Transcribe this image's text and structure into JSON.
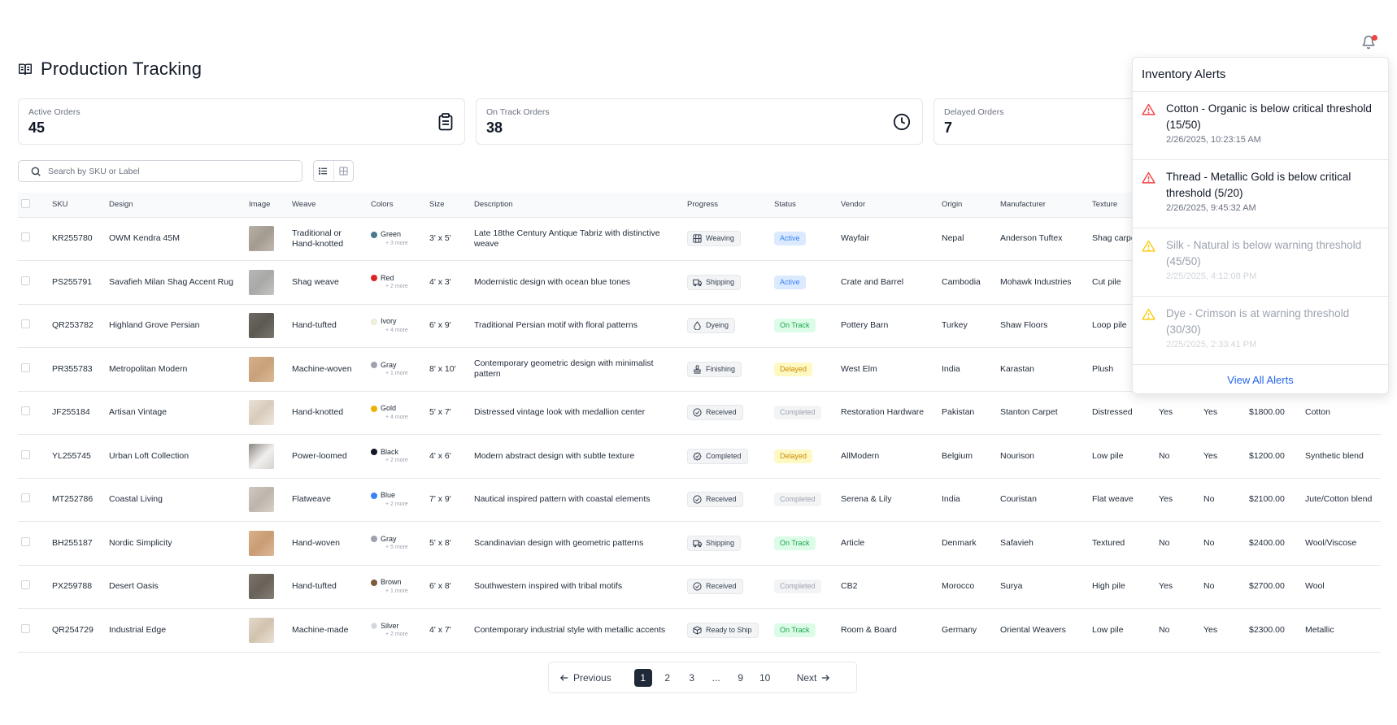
{
  "header": {
    "title": "Production Tracking"
  },
  "stats": [
    {
      "label": "Active Orders",
      "value": "45",
      "icon": "clipboard-icon"
    },
    {
      "label": "On Track Orders",
      "value": "38",
      "icon": "clock-icon"
    },
    {
      "label": "Delayed Orders",
      "value": "7",
      "icon": "alert-icon"
    }
  ],
  "search": {
    "placeholder": "Search by SKU or Label",
    "value": ""
  },
  "table": {
    "columns": [
      "SKU",
      "Design",
      "Image",
      "Weave",
      "Colors",
      "Size",
      "Description",
      "Progress",
      "Status",
      "Vendor",
      "Origin",
      "Manufacturer",
      "Texture",
      "",
      "",
      "",
      ""
    ],
    "rows": [
      {
        "sku": "KR255780",
        "design": "OWM Kendra 45M",
        "weave": "Traditional or Hand-knotted",
        "color": "Green",
        "color_more": "+ 3 more",
        "size": "3' x 5'",
        "description": "Late 18the Century Antique Tabriz with distinctive weave",
        "progress": "Weaving",
        "status": "Active",
        "vendor": "Wayfair",
        "origin": "Nepal",
        "manufacturer": "Anderson Tuftex",
        "texture": "Shag carpet",
        "c1": "",
        "c2": "",
        "price": "",
        "material": ""
      },
      {
        "sku": "PS255791",
        "design": "Savafieh Milan Shag Accent Rug",
        "weave": "Shag weave",
        "color": "Red",
        "color_more": "+ 2 more",
        "size": "4' x 3'",
        "description": "Modernistic design with ocean blue tones",
        "progress": "Shipping",
        "status": "Active",
        "vendor": "Crate and Barrel",
        "origin": "Cambodia",
        "manufacturer": "Mohawk Industries",
        "texture": "Cut pile",
        "c1": "",
        "c2": "",
        "price": "",
        "material": ""
      },
      {
        "sku": "QR253782",
        "design": "Highland Grove Persian",
        "weave": "Hand-tufted",
        "color": "Ivory",
        "color_more": "+ 4 more",
        "size": "6' x 9'",
        "description": "Traditional Persian motif with floral patterns",
        "progress": "Dyeing",
        "status": "On Track",
        "vendor": "Pottery Barn",
        "origin": "Turkey",
        "manufacturer": "Shaw Floors",
        "texture": "Loop pile",
        "c1": "",
        "c2": "",
        "price": "",
        "material": ""
      },
      {
        "sku": "PR355783",
        "design": "Metropolitan Modern",
        "weave": "Machine-woven",
        "color": "Gray",
        "color_more": "+ 1 more",
        "size": "8' x 10'",
        "description": "Contemporary geometric design with minimalist pattern",
        "progress": "Finishing",
        "status": "Delayed",
        "vendor": "West Elm",
        "origin": "India",
        "manufacturer": "Karastan",
        "texture": "Plush",
        "c1": "",
        "c2": "",
        "price": "",
        "material": ""
      },
      {
        "sku": "JF255184",
        "design": "Artisan Vintage",
        "weave": "Hand-knotted",
        "color": "Gold",
        "color_more": "+ 4 more",
        "size": "5' x 7'",
        "description": "Distressed vintage look with medallion center",
        "progress": "Received",
        "status": "Completed",
        "vendor": "Restoration Hardware",
        "origin": "Pakistan",
        "manufacturer": "Stanton Carpet",
        "texture": "Distressed",
        "c1": "Yes",
        "c2": "Yes",
        "price": "$1800.00",
        "material": "Cotton"
      },
      {
        "sku": "YL255745",
        "design": "Urban Loft Collection",
        "weave": "Power-loomed",
        "color": "Black",
        "color_more": "+ 2 more",
        "size": "4' x 6'",
        "description": "Modern abstract design with subtle texture",
        "progress": "Completed",
        "status": "Delayed",
        "vendor": "AllModern",
        "origin": "Belgium",
        "manufacturer": "Nourison",
        "texture": "Low pile",
        "c1": "No",
        "c2": "Yes",
        "price": "$1200.00",
        "material": "Synthetic blend"
      },
      {
        "sku": "MT252786",
        "design": "Coastal Living",
        "weave": "Flatweave",
        "color": "Blue",
        "color_more": "+ 2 more",
        "size": "7' x 9'",
        "description": "Nautical inspired pattern with coastal elements",
        "progress": "Received",
        "status": "Completed",
        "vendor": "Serena & Lily",
        "origin": "India",
        "manufacturer": "Couristan",
        "texture": "Flat weave",
        "c1": "Yes",
        "c2": "No",
        "price": "$2100.00",
        "material": "Jute/Cotton blend"
      },
      {
        "sku": "BH255187",
        "design": "Nordic Simplicity",
        "weave": "Hand-woven",
        "color": "Gray",
        "color_more": "+ 5 more",
        "size": "5' x 8'",
        "description": "Scandinavian design with geometric patterns",
        "progress": "Shipping",
        "status": "On Track",
        "vendor": "Article",
        "origin": "Denmark",
        "manufacturer": "Safavieh",
        "texture": "Textured",
        "c1": "No",
        "c2": "No",
        "price": "$2400.00",
        "material": "Wool/Viscose"
      },
      {
        "sku": "PX259788",
        "design": "Desert Oasis",
        "weave": "Hand-tufted",
        "color": "Brown",
        "color_more": "+ 1 more",
        "size": "6' x 8'",
        "description": "Southwestern inspired with tribal motifs",
        "progress": "Received",
        "status": "Completed",
        "vendor": "CB2",
        "origin": "Morocco",
        "manufacturer": "Surya",
        "texture": "High pile",
        "c1": "Yes",
        "c2": "No",
        "price": "$2700.00",
        "material": "Wool"
      },
      {
        "sku": "QR254729",
        "design": "Industrial Edge",
        "weave": "Machine-made",
        "color": "Silver",
        "color_more": "+ 2 more",
        "size": "4' x 7'",
        "description": "Contemporary industrial style with metallic accents",
        "progress": "Ready to Ship",
        "status": "On Track",
        "vendor": "Room & Board",
        "origin": "Germany",
        "manufacturer": "Oriental Weavers",
        "texture": "Low pile",
        "c1": "No",
        "c2": "Yes",
        "price": "$2300.00",
        "material": "Metallic"
      }
    ]
  },
  "alerts": {
    "title": "Inventory Alerts",
    "items": [
      {
        "message": "Cotton - Organic is below critical threshold (15/50)",
        "time": "2/26/2025, 10:23:15 AM",
        "level": "critical"
      },
      {
        "message": "Thread - Metallic Gold is below critical threshold (5/20)",
        "time": "2/26/2025, 9:45:32 AM",
        "level": "critical"
      },
      {
        "message": "Silk - Natural is below warning threshold (45/50)",
        "time": "2/25/2025, 4:12:08 PM",
        "level": "warning"
      },
      {
        "message": "Dye - Crimson is at warning threshold (30/30)",
        "time": "2/25/2025, 2:33:41 PM",
        "level": "warning"
      }
    ],
    "view_all": "View All Alerts"
  },
  "pagination": {
    "previous": "Previous",
    "next": "Next",
    "pages": [
      "1",
      "2",
      "3",
      "...",
      "9",
      "10"
    ],
    "current": "1"
  },
  "colors": {
    "critical": "#ef4444",
    "warning": "#facc15",
    "link": "#2563eb",
    "status_active": {
      "bg": "#dbeafe",
      "fg": "#3b82f6"
    },
    "status_on_track": {
      "bg": "#dcfce7",
      "fg": "#16a34a"
    },
    "status_delayed": {
      "bg": "#fef9c3",
      "fg": "#ca8a04"
    },
    "status_completed": {
      "bg": "#f3f4f6",
      "fg": "#9ca3af"
    },
    "swatches": {
      "Green": "#4b7a8f",
      "Red": "#dc2626",
      "Ivory": "#f5efcf",
      "Gray": "#9ca3af",
      "Gold": "#eab308",
      "Black": "#111827",
      "Blue": "#3b82f6",
      "Brown": "#7c5a3a",
      "Silver": "#d1d5db"
    }
  }
}
